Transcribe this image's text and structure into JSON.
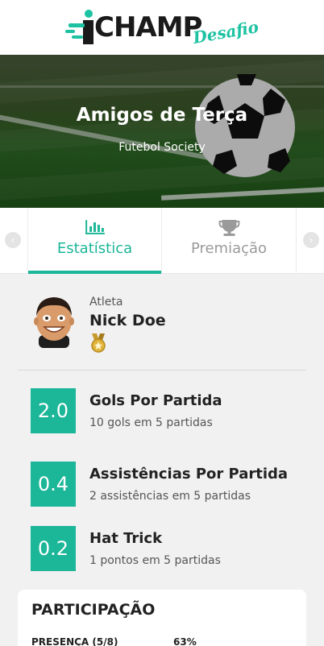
{
  "app": {
    "logo_main": "CHAMP",
    "logo_accent": "Desafio"
  },
  "hero": {
    "title": "Amigos de Terça",
    "subtitle": "Futebol Society"
  },
  "tabs": [
    {
      "label": "Estatística",
      "icon": "bar-chart-icon",
      "active": true
    },
    {
      "label": "Premiação",
      "icon": "trophy-icon",
      "active": false
    }
  ],
  "athlete": {
    "role": "Atleta",
    "name": "Nick Doe",
    "badge_icon": "gold-medal-icon"
  },
  "stats": [
    {
      "value": "2.0",
      "title": "Gols Por Partida",
      "desc": "10 gols em 5 partidas"
    },
    {
      "value": "0.4",
      "title": "Assistências Por Partida",
      "desc": "2 assistências em 5 partidas"
    },
    {
      "value": "0.2",
      "title": "Hat Trick",
      "desc": "1 pontos em 5 partidas"
    }
  ],
  "participation": {
    "title": "PARTICIPAÇÃO",
    "rows": [
      {
        "label": "PRESENÇA (5/8)",
        "value": "63%"
      }
    ]
  },
  "colors": {
    "accent": "#1cb698",
    "logo_green": "#1cc2a2",
    "background": "#f1f1f1"
  }
}
